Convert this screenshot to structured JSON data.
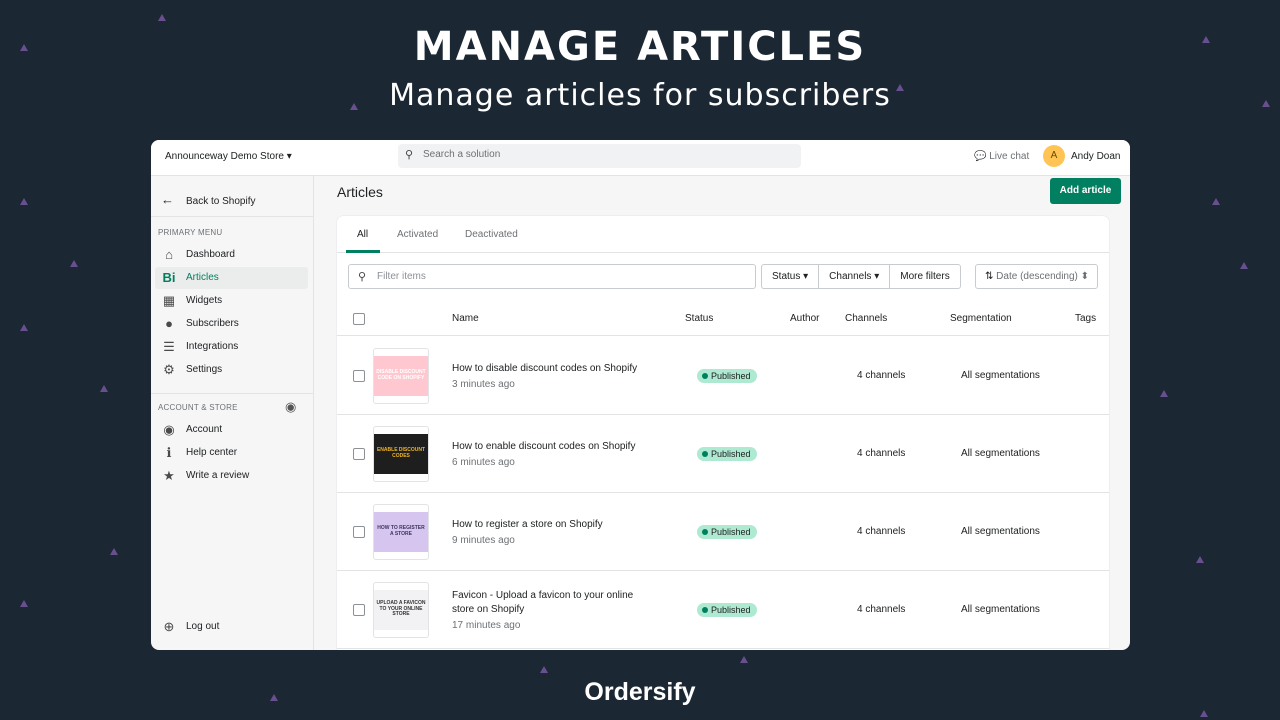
{
  "hero": {
    "title": "MANAGE ARTICLES",
    "subtitle": "Manage articles for subscribers",
    "brand": "Ordersify"
  },
  "colors": {
    "background": "#1b2733",
    "accent": "#008060",
    "badge": "#aee9d1",
    "avatar": "#ffc453"
  },
  "topbar": {
    "store": "Announceway Demo Store",
    "store_icon": "caret-down-icon",
    "search_placeholder": "Search a solution",
    "live_chat": "Live chat",
    "avatar_initial": "A",
    "user": "Andy Doan"
  },
  "sidebar": {
    "back": "Back to Shopify",
    "primary_label": "PRIMARY MENU",
    "primary": [
      {
        "label": "Dashboard",
        "icon": "home-icon",
        "glyph": "⌂"
      },
      {
        "label": "Articles",
        "icon": "articles-icon",
        "glyph": "Bi",
        "active": true
      },
      {
        "label": "Widgets",
        "icon": "widgets-icon",
        "glyph": "▦"
      },
      {
        "label": "Subscribers",
        "icon": "person-icon",
        "glyph": "●"
      },
      {
        "label": "Integrations",
        "icon": "integrations-icon",
        "glyph": "☰"
      },
      {
        "label": "Settings",
        "icon": "gear-icon",
        "glyph": "⚙"
      }
    ],
    "account_label": "ACCOUNT & STORE",
    "account": [
      {
        "label": "Account",
        "icon": "account-icon",
        "glyph": "◉"
      },
      {
        "label": "Help center",
        "icon": "info-icon",
        "glyph": "ℹ"
      },
      {
        "label": "Write a review",
        "icon": "star-icon",
        "glyph": "★"
      }
    ],
    "logout": "Log out"
  },
  "main": {
    "title": "Articles",
    "add_button": "Add article",
    "tabs": [
      "All",
      "Activated",
      "Deactivated"
    ],
    "filter_placeholder": "Filter items",
    "filters": [
      "Status",
      "Channels",
      "More filters"
    ],
    "sort": "Date (descending)",
    "columns": [
      "Name",
      "Status",
      "Author",
      "Channels",
      "Segmentation",
      "Tags"
    ],
    "rows": [
      {
        "name": "How to disable discount codes on Shopify",
        "time": "3 minutes ago",
        "status": "Published",
        "author": "",
        "channels": "4 channels",
        "segmentation": "All segmentations",
        "thumb_text": "DISABLE DISCOUNT CODE ON SHOPIFY",
        "thumb_bg": "#ffc7cf",
        "thumb_fg": "#ffffff"
      },
      {
        "name": "How to enable discount codes on Shopify",
        "time": "6 minutes ago",
        "status": "Published",
        "author": "",
        "channels": "4 channels",
        "segmentation": "All segmentations",
        "thumb_text": "ENABLE DISCOUNT CODES",
        "thumb_bg": "#1e1e1e",
        "thumb_fg": "#f2b71f"
      },
      {
        "name": "How to register a store on Shopify",
        "time": "9 minutes ago",
        "status": "Published",
        "author": "",
        "channels": "4 channels",
        "segmentation": "All segmentations",
        "thumb_text": "HOW TO REGISTER A STORE",
        "thumb_bg": "#d6c5ee",
        "thumb_fg": "#3b3560"
      },
      {
        "name": "Favicon - Upload a favicon to your online store on Shopify",
        "time": "17 minutes ago",
        "status": "Published",
        "author": "",
        "channels": "4 channels",
        "segmentation": "All segmentations",
        "thumb_text": "UPLOAD A FAVICON TO YOUR ONLINE STORE",
        "thumb_bg": "#f2f2f4",
        "thumb_fg": "#333333"
      }
    ]
  }
}
